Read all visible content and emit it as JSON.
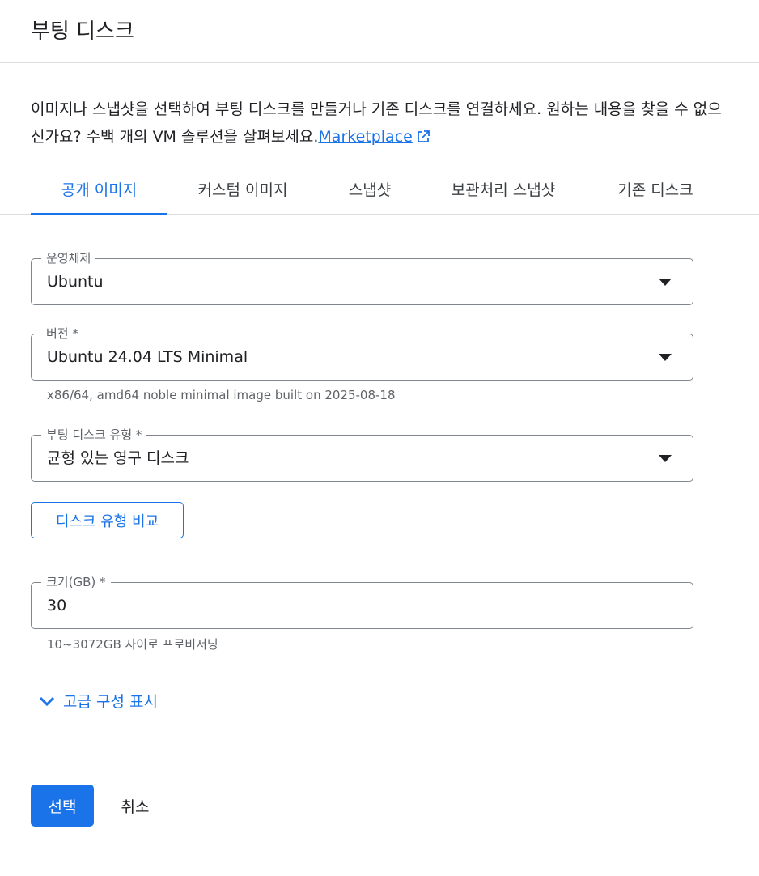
{
  "header": {
    "title": "부팅 디스크"
  },
  "description": {
    "text": "이미지나 스냅샷을 선택하여 부팅 디스크를 만들거나 기존 디스크를 연결하세요. 원하는 내용을 찾을 수 없으신가요? 수백 개의 VM 솔루션을 살펴보세요.",
    "link_label": "Marketplace",
    "link_icon": "external-link-icon"
  },
  "tabs": [
    {
      "label": "공개 이미지",
      "active": true
    },
    {
      "label": "커스텀 이미지",
      "active": false
    },
    {
      "label": "스냅샷",
      "active": false
    },
    {
      "label": "보관처리 스냅샷",
      "active": false
    },
    {
      "label": "기존 디스크",
      "active": false
    }
  ],
  "form": {
    "os": {
      "label": "운영체제",
      "value": "Ubuntu"
    },
    "version": {
      "label": "버전 *",
      "value": "Ubuntu 24.04 LTS Minimal",
      "hint": "x86/64, amd64 noble minimal image built on 2025-08-18"
    },
    "disk_type": {
      "label": "부팅 디스크 유형 *",
      "value": "균형 있는 영구 디스크"
    },
    "compare_button": "디스크 유형 비교",
    "size": {
      "label": "크기(GB) *",
      "value": "30",
      "hint": "10~3072GB 사이로 프로비저닝"
    },
    "advanced_toggle": "고급 구성 표시"
  },
  "actions": {
    "select": "선택",
    "cancel": "취소"
  },
  "colors": {
    "accent": "#1a73e8",
    "text": "#202124",
    "secondary_text": "#5f6368",
    "border": "#80868b"
  }
}
